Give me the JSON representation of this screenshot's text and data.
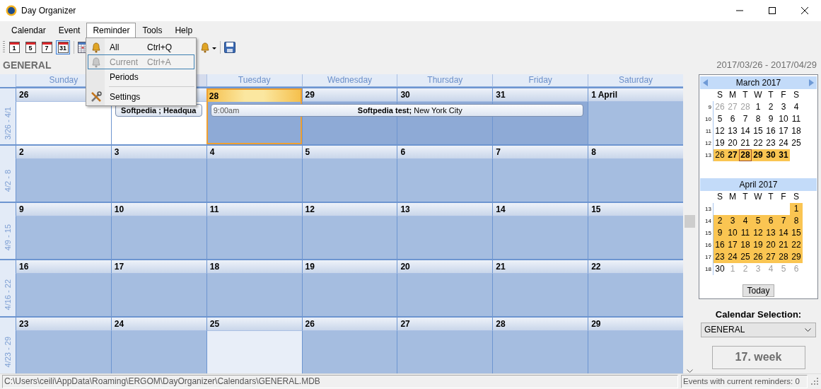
{
  "window": {
    "title": "Day Organizer"
  },
  "menu": [
    {
      "label": "Calendar",
      "selected": false
    },
    {
      "label": "Event",
      "selected": false
    },
    {
      "label": "Reminder",
      "selected": true
    },
    {
      "label": "Tools",
      "selected": false
    },
    {
      "label": "Help",
      "selected": false
    }
  ],
  "toolbar": {
    "day_buttons": [
      {
        "label": "1",
        "selected": false
      },
      {
        "label": "5",
        "selected": false
      },
      {
        "label": "7",
        "selected": false
      },
      {
        "label": "31",
        "selected": true
      }
    ]
  },
  "reminder_menu": [
    {
      "kind": "alert",
      "label": "All",
      "shortcut": "Ctrl+Q",
      "disabled": false,
      "selected": false
    },
    {
      "kind": "alert",
      "label": "Current",
      "shortcut": "Ctrl+A",
      "disabled": true,
      "selected": true
    },
    {
      "kind": "item",
      "label": "Periods",
      "disabled": false,
      "selected": false
    },
    {
      "kind": "separator"
    },
    {
      "kind": "setup",
      "label": "Settings",
      "disabled": false,
      "selected": false
    }
  ],
  "calendar_name": "GENERAL",
  "date_range": "2017/03/26 - 2017/04/29",
  "weekdays": [
    {
      "label": "Sunday",
      "covered": false
    },
    {
      "covered": true
    },
    {
      "label": "Tuesday",
      "covered": false
    },
    {
      "label": "Wednesday",
      "covered": false
    },
    {
      "label": "Thursday",
      "covered": false
    },
    {
      "label": "Friday",
      "covered": false
    },
    {
      "label": "Saturday",
      "covered": false
    }
  ],
  "weeks": [
    {
      "label": "3/26 - 4/1",
      "days": [
        {
          "date": "26",
          "kind": "blank",
          "selected": false
        },
        {
          "kind": "blank",
          "selected": false,
          "event": {
            "title": "Softpedia ; Headqua"
          }
        },
        {
          "date": "28",
          "kind": "booked",
          "selected": true,
          "event": {
            "time": "9:00am",
            "title": "Softpedia test;",
            "location": "New York City"
          }
        },
        {
          "date": "29",
          "kind": "booked",
          "selected": false,
          "continues_event": true
        },
        {
          "date": "30",
          "kind": "booked",
          "selected": false,
          "continues_event": true
        },
        {
          "date": "31",
          "kind": "booked",
          "selected": false,
          "continues_event": true
        },
        {
          "date": "1 April",
          "kind": "normal",
          "selected": false,
          "continues_event": false
        }
      ]
    },
    {
      "label": "4/2 - 8",
      "days": [
        {
          "date": "2",
          "kind": "normal",
          "selected": false
        },
        {
          "date": "3",
          "kind": "normal",
          "selected": false
        },
        {
          "date": "4",
          "kind": "normal",
          "selected": false
        },
        {
          "date": "5",
          "kind": "normal",
          "selected": false
        },
        {
          "date": "6",
          "kind": "normal",
          "selected": false
        },
        {
          "date": "7",
          "kind": "normal",
          "selected": false
        },
        {
          "date": "8",
          "kind": "normal",
          "selected": false
        }
      ]
    },
    {
      "label": "4/9 - 15",
      "days": [
        {
          "date": "9",
          "kind": "normal",
          "selected": false
        },
        {
          "date": "10",
          "kind": "normal",
          "selected": false
        },
        {
          "date": "11",
          "kind": "normal",
          "selected": false
        },
        {
          "date": "12",
          "kind": "normal",
          "selected": false
        },
        {
          "date": "13",
          "kind": "normal",
          "selected": false
        },
        {
          "date": "14",
          "kind": "normal",
          "selected": false
        },
        {
          "date": "15",
          "kind": "normal",
          "selected": false
        }
      ]
    },
    {
      "label": "4/16 - 22",
      "days": [
        {
          "date": "16",
          "kind": "normal",
          "selected": false
        },
        {
          "date": "17",
          "kind": "normal",
          "selected": false
        },
        {
          "date": "18",
          "kind": "normal",
          "selected": false
        },
        {
          "date": "19",
          "kind": "normal",
          "selected": false
        },
        {
          "date": "20",
          "kind": "normal",
          "selected": false
        },
        {
          "date": "21",
          "kind": "normal",
          "selected": false
        },
        {
          "date": "22",
          "kind": "normal",
          "selected": false
        }
      ]
    },
    {
      "label": "4/23 - 29",
      "days": [
        {
          "date": "23",
          "kind": "normal",
          "selected": false
        },
        {
          "date": "24",
          "kind": "normal",
          "selected": false
        },
        {
          "date": "25",
          "kind": "faint",
          "selected": false
        },
        {
          "date": "26",
          "kind": "normal",
          "selected": false
        },
        {
          "date": "27",
          "kind": "normal",
          "selected": false
        },
        {
          "date": "28",
          "kind": "normal",
          "selected": false
        },
        {
          "date": "29",
          "kind": "normal",
          "selected": false
        }
      ]
    }
  ],
  "mini_months": [
    {
      "title": "March 2017",
      "navigation": true,
      "weekdays": [
        "S",
        "M",
        "T",
        "W",
        "T",
        "F",
        "S"
      ],
      "rows": [
        {
          "week": "9",
          "days": [
            {
              "t": "26",
              "kind": "other",
              "selected": false
            },
            {
              "t": "27",
              "kind": "other",
              "selected": false
            },
            {
              "t": "28",
              "kind": "other",
              "selected": false
            },
            {
              "t": "1",
              "kind": "plain",
              "selected": false
            },
            {
              "t": "2",
              "kind": "plain",
              "selected": false
            },
            {
              "t": "3",
              "kind": "plain",
              "selected": false
            },
            {
              "t": "4",
              "kind": "plain",
              "selected": false
            }
          ]
        },
        {
          "week": "10",
          "days": [
            {
              "t": "5",
              "kind": "plain",
              "selected": false
            },
            {
              "t": "6",
              "kind": "plain",
              "selected": false
            },
            {
              "t": "7",
              "kind": "plain",
              "selected": false
            },
            {
              "t": "8",
              "kind": "plain",
              "selected": false
            },
            {
              "t": "9",
              "kind": "plain",
              "selected": false
            },
            {
              "t": "10",
              "kind": "plain",
              "selected": false
            },
            {
              "t": "11",
              "kind": "plain",
              "selected": false
            }
          ]
        },
        {
          "week": "11",
          "days": [
            {
              "t": "12",
              "kind": "plain",
              "selected": false
            },
            {
              "t": "13",
              "kind": "plain",
              "selected": false
            },
            {
              "t": "14",
              "kind": "plain",
              "selected": false
            },
            {
              "t": "15",
              "kind": "plain",
              "selected": false
            },
            {
              "t": "16",
              "kind": "plain",
              "selected": false
            },
            {
              "t": "17",
              "kind": "plain",
              "selected": false
            },
            {
              "t": "18",
              "kind": "plain",
              "selected": false
            }
          ]
        },
        {
          "week": "12",
          "days": [
            {
              "t": "19",
              "kind": "plain",
              "selected": false
            },
            {
              "t": "20",
              "kind": "plain",
              "selected": false
            },
            {
              "t": "21",
              "kind": "plain",
              "selected": false
            },
            {
              "t": "22",
              "kind": "plain",
              "selected": false
            },
            {
              "t": "23",
              "kind": "plain",
              "selected": false
            },
            {
              "t": "24",
              "kind": "plain",
              "selected": false
            },
            {
              "t": "25",
              "kind": "plain",
              "selected": false
            }
          ]
        },
        {
          "week": "13",
          "days": [
            {
              "t": "26",
              "kind": "range",
              "selected": false
            },
            {
              "t": "27",
              "kind": "range-bold",
              "selected": false
            },
            {
              "t": "28",
              "kind": "range-bold",
              "selected": true
            },
            {
              "t": "29",
              "kind": "range-bold",
              "selected": false
            },
            {
              "t": "30",
              "kind": "range-bold",
              "selected": false
            },
            {
              "t": "31",
              "kind": "range-bold",
              "selected": false
            },
            {
              "kind": "blank",
              "selected": false
            }
          ]
        }
      ]
    },
    {
      "title": "April 2017",
      "navigation": false,
      "weekdays": [
        "S",
        "M",
        "T",
        "W",
        "T",
        "F",
        "S"
      ],
      "rows": [
        {
          "week": "13",
          "days": [
            {
              "kind": "blank",
              "selected": false
            },
            {
              "kind": "blank",
              "selected": false
            },
            {
              "kind": "blank",
              "selected": false
            },
            {
              "kind": "blank",
              "selected": false
            },
            {
              "kind": "blank",
              "selected": false
            },
            {
              "kind": "blank",
              "selected": false
            },
            {
              "t": "1",
              "kind": "range",
              "selected": false
            }
          ]
        },
        {
          "week": "14",
          "days": [
            {
              "t": "2",
              "kind": "range",
              "selected": false
            },
            {
              "t": "3",
              "kind": "range",
              "selected": false
            },
            {
              "t": "4",
              "kind": "range",
              "selected": false
            },
            {
              "t": "5",
              "kind": "range",
              "selected": false
            },
            {
              "t": "6",
              "kind": "range",
              "selected": false
            },
            {
              "t": "7",
              "kind": "range",
              "selected": false
            },
            {
              "t": "8",
              "kind": "range",
              "selected": false
            }
          ]
        },
        {
          "week": "15",
          "days": [
            {
              "t": "9",
              "kind": "range",
              "selected": false
            },
            {
              "t": "10",
              "kind": "range",
              "selected": false
            },
            {
              "t": "11",
              "kind": "range",
              "selected": false
            },
            {
              "t": "12",
              "kind": "range",
              "selected": false
            },
            {
              "t": "13",
              "kind": "range",
              "selected": false
            },
            {
              "t": "14",
              "kind": "range",
              "selected": false
            },
            {
              "t": "15",
              "kind": "range",
              "selected": false
            }
          ]
        },
        {
          "week": "16",
          "days": [
            {
              "t": "16",
              "kind": "range",
              "selected": false
            },
            {
              "t": "17",
              "kind": "range",
              "selected": false
            },
            {
              "t": "18",
              "kind": "range",
              "selected": false
            },
            {
              "t": "19",
              "kind": "range",
              "selected": false
            },
            {
              "t": "20",
              "kind": "range",
              "selected": false
            },
            {
              "t": "21",
              "kind": "range",
              "selected": false
            },
            {
              "t": "22",
              "kind": "range",
              "selected": false
            }
          ]
        },
        {
          "week": "17",
          "days": [
            {
              "t": "23",
              "kind": "range",
              "selected": false
            },
            {
              "t": "24",
              "kind": "range",
              "selected": false
            },
            {
              "t": "25",
              "kind": "range",
              "selected": false
            },
            {
              "t": "26",
              "kind": "range",
              "selected": false
            },
            {
              "t": "27",
              "kind": "range",
              "selected": false
            },
            {
              "t": "28",
              "kind": "range",
              "selected": false
            },
            {
              "t": "29",
              "kind": "range",
              "selected": false
            }
          ]
        },
        {
          "week": "18",
          "days": [
            {
              "t": "30",
              "kind": "plain",
              "selected": false
            },
            {
              "t": "1",
              "kind": "other",
              "selected": false
            },
            {
              "t": "2",
              "kind": "other",
              "selected": false
            },
            {
              "t": "3",
              "kind": "other",
              "selected": false
            },
            {
              "t": "4",
              "kind": "other",
              "selected": false
            },
            {
              "t": "5",
              "kind": "other",
              "selected": false
            },
            {
              "t": "6",
              "kind": "other",
              "selected": false
            }
          ]
        }
      ]
    }
  ],
  "today_button": "Today",
  "calendar_selection": {
    "label": "Calendar Selection:",
    "value": "GENERAL"
  },
  "week_label": "17. week",
  "status_bar": {
    "path": "C:\\Users\\ceili\\AppData\\Roaming\\ERGOM\\DayOrganizer\\Calendars\\GENERAL.MDB",
    "reminders": "Events with current reminders: 0"
  }
}
